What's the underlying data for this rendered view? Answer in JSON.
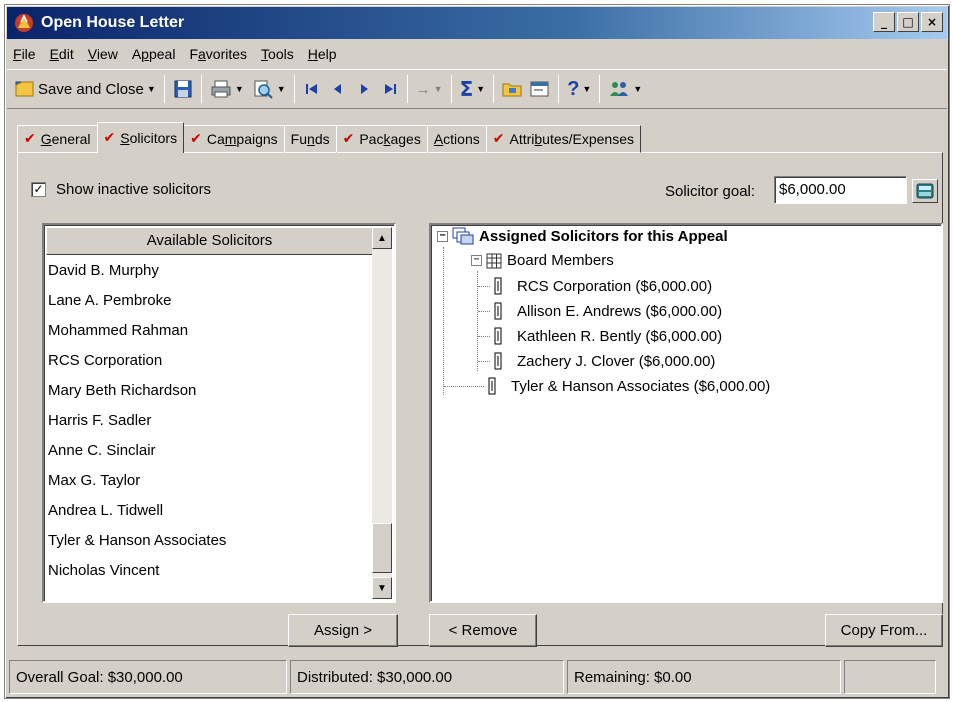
{
  "window": {
    "title": "Open House Letter"
  },
  "menu": [
    {
      "pre": "",
      "u": "F",
      "post": "ile"
    },
    {
      "pre": "",
      "u": "E",
      "post": "dit"
    },
    {
      "pre": "",
      "u": "V",
      "post": "iew"
    },
    {
      "pre": "A",
      "u": "p",
      "post": "peal"
    },
    {
      "pre": "F",
      "u": "a",
      "post": "vorites"
    },
    {
      "pre": "",
      "u": "T",
      "post": "ools"
    },
    {
      "pre": "",
      "u": "H",
      "post": "elp"
    }
  ],
  "toolbar": {
    "save_close_label": "Save and Close"
  },
  "tabs": [
    {
      "label_pre": "",
      "label_u": "G",
      "label_post": "eneral",
      "checked": true
    },
    {
      "label_pre": "",
      "label_u": "S",
      "label_post": "olicitors",
      "checked": true
    },
    {
      "label_pre": "Ca",
      "label_u": "m",
      "label_post": "paigns",
      "checked": true
    },
    {
      "label_pre": "Fu",
      "label_u": "n",
      "label_post": "ds",
      "checked": false
    },
    {
      "label_pre": "Pac",
      "label_u": "k",
      "label_post": "ages",
      "checked": true
    },
    {
      "label_pre": "",
      "label_u": "A",
      "label_post": "ctions",
      "checked": false
    },
    {
      "label_pre": "Attri",
      "label_u": "b",
      "label_post": "utes/Expenses",
      "checked": true
    }
  ],
  "options": {
    "show_inactive_label": "Show inactive solicitors",
    "show_inactive_checked": "✓"
  },
  "goal": {
    "label": "Solicitor goal:",
    "value": "$6,000.00"
  },
  "available": {
    "header": "Available Solicitors",
    "items": [
      "David B. Murphy",
      "Lane A. Pembroke",
      "Mohammed Rahman",
      "RCS Corporation",
      "Mary Beth Richardson",
      "Harris F. Sadler",
      "Anne C. Sinclair",
      "Max G. Taylor",
      "Andrea L. Tidwell",
      "Tyler & Hanson Associates",
      "Nicholas Vincent"
    ]
  },
  "assigned": {
    "root": "Assigned Solicitors for this Appeal",
    "group": "Board Members",
    "group_items": [
      "RCS Corporation ($6,000.00)",
      "Allison E. Andrews ($6,000.00)",
      "Kathleen R. Bently ($6,000.00)",
      "Zachery J. Clover ($6,000.00)"
    ],
    "other": "Tyler & Hanson Associates ($6,000.00)"
  },
  "buttons": {
    "assign": "Assign >",
    "remove": "< Remove",
    "copy_from": "Copy From..."
  },
  "status": {
    "overall": "Overall Goal: $30,000.00",
    "distributed": "Distributed: $30,000.00",
    "remaining": "Remaining: $0.00"
  }
}
